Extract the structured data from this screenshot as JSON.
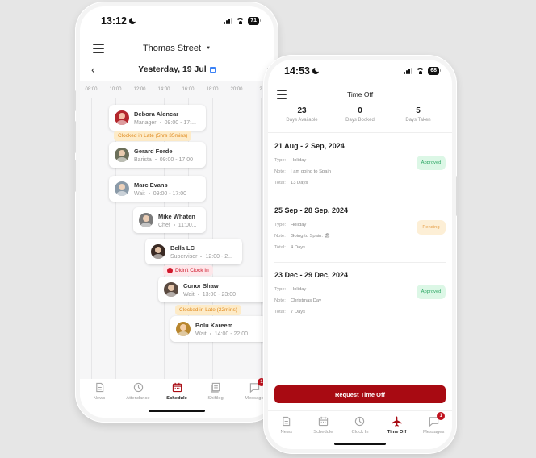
{
  "colors": {
    "accent": "#a80a12",
    "approved_bg": "#dcf7e6",
    "approved_text": "#2fa866",
    "pending_bg": "#fdefd6",
    "pending_text": "#e6a04a",
    "late_bg": "#fdebc8",
    "late_text": "#e08a1e",
    "missed_bg": "#fde7ea",
    "missed_text": "#d0182b",
    "calendar_icon": "#3b82f6"
  },
  "schedule_phone": {
    "status_bar": {
      "time": "13:12",
      "battery": "71"
    },
    "header": {
      "location": "Thomas Street",
      "location_caret": "▼"
    },
    "date_nav": {
      "prev": "‹",
      "label": "Yesterday, 19 Jul",
      "next": "›"
    },
    "hours": [
      "08:00",
      "10:00",
      "12:00",
      "14:00",
      "16:00",
      "18:00",
      "20:00",
      "2"
    ],
    "shifts": [
      {
        "name": "Debora Alencar",
        "role": "Manager",
        "time": "09:00 - 17:...",
        "avatar_color": "#b3262c",
        "tag": null
      },
      {
        "name": "Gerard Forde",
        "role": "Barista",
        "time": "09:00 - 17:00",
        "avatar_color": "#6b6f5a",
        "tag": {
          "type": "late",
          "text": "Clocked in Late (5hrs 35mins)"
        }
      },
      {
        "name": "Marc Evans",
        "role": "Wait",
        "time": "09:00 - 17:00",
        "avatar_color": "#8a9aa8",
        "tag": null
      },
      {
        "name": "Mike Whaten",
        "role": "Chef",
        "time": "11:00...",
        "avatar_color": "#7a7a7a",
        "tag": null
      },
      {
        "name": "Bella LC",
        "role": "Supervisor",
        "time": "12:00 - 2...",
        "avatar_color": "#3a2a24",
        "tag": null
      },
      {
        "name": "Conor Shaw",
        "role": "Wait",
        "time": "13:00 - 23:00",
        "avatar_color": "#5a4a40",
        "tag": {
          "type": "missed",
          "text": "Didn't Clock In",
          "icon": "!"
        }
      },
      {
        "name": "Bolu Kareem",
        "role": "Wait",
        "time": "14:00 - 22:00",
        "avatar_color": "#b8862e",
        "tag": {
          "type": "late",
          "text": "Clocked in Late (22mins)"
        }
      }
    ],
    "tabs": [
      {
        "label": "News",
        "icon": "news-icon",
        "active": false
      },
      {
        "label": "Attendance",
        "icon": "clock-icon",
        "active": false
      },
      {
        "label": "Schedule",
        "icon": "calendar-icon",
        "active": true
      },
      {
        "label": "Shiftlog",
        "icon": "shiftlog-icon",
        "active": false
      },
      {
        "label": "Message",
        "icon": "message-icon",
        "active": false,
        "badge": "1"
      }
    ]
  },
  "timeoff_phone": {
    "status_bar": {
      "time": "14:53",
      "battery": "68"
    },
    "header": {
      "title": "Time Off"
    },
    "stats": [
      {
        "value": "23",
        "label": "Days Available"
      },
      {
        "value": "0",
        "label": "Days Booked"
      },
      {
        "value": "5",
        "label": "Days Taken"
      }
    ],
    "field_labels": {
      "type": "Type:",
      "note": "Note:",
      "total": "Total:"
    },
    "requests": [
      {
        "range": "21 Aug - 2 Sep, 2024",
        "type": "Holiday",
        "note": "I am going to Spain",
        "total": "13 Days",
        "status": "Approved",
        "status_key": "approved"
      },
      {
        "range": "25 Sep - 28 Sep, 2024",
        "type": "Holiday",
        "note": "Going to Spain. 🏖",
        "total": "4 Days",
        "status": "Pending",
        "status_key": "pending"
      },
      {
        "range": "23 Dec - 29 Dec, 2024",
        "type": "Holiday",
        "note": "Christmas Day",
        "total": "7 Days",
        "status": "Approved",
        "status_key": "approved"
      }
    ],
    "cta_label": "Request Time Off",
    "tabs": [
      {
        "label": "News",
        "icon": "news-icon",
        "active": false
      },
      {
        "label": "Schedule",
        "icon": "calendar-icon",
        "active": false
      },
      {
        "label": "Clock In",
        "icon": "clock-icon",
        "active": false
      },
      {
        "label": "Time Off",
        "icon": "airplane-icon",
        "active": true
      },
      {
        "label": "Messages",
        "icon": "message-icon",
        "active": false,
        "badge": "1"
      }
    ]
  }
}
